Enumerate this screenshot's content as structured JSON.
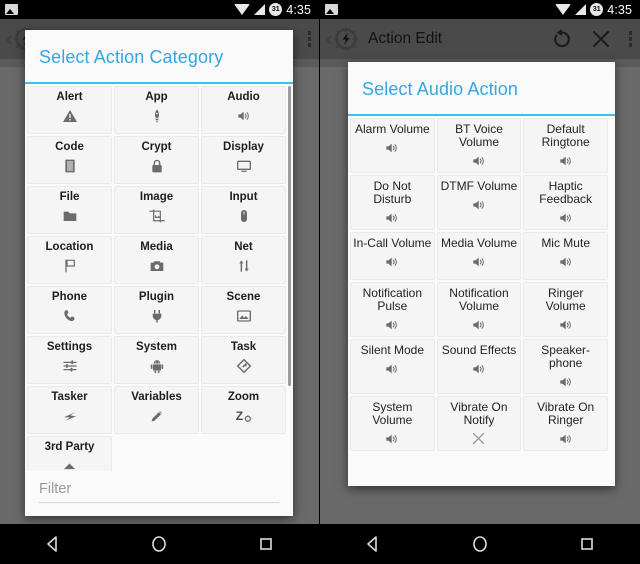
{
  "statusbar": {
    "time": "4:35",
    "icons": [
      "image-icon",
      "wifi-icon",
      "signal-icon",
      "calendar-icon"
    ],
    "calendar_day": "31"
  },
  "left_screen": {
    "toolbar": {
      "back_label": "‹",
      "logo": "tasker-logo-icon",
      "title": "",
      "overflow": "overflow-menu-icon"
    },
    "dialog": {
      "title": "Select Action Category",
      "filter_placeholder": "Filter",
      "filter_value": "",
      "items": [
        {
          "label": "Alert",
          "icon": "warning-triangle-icon"
        },
        {
          "label": "App",
          "icon": "rocket-icon"
        },
        {
          "label": "Audio",
          "icon": "speaker-icon"
        },
        {
          "label": "Code",
          "icon": "document-lines-icon"
        },
        {
          "label": "Crypt",
          "icon": "lock-icon"
        },
        {
          "label": "Display",
          "icon": "monitor-icon"
        },
        {
          "label": "File",
          "icon": "folder-icon"
        },
        {
          "label": "Image",
          "icon": "crop-image-icon"
        },
        {
          "label": "Input",
          "icon": "mouse-icon"
        },
        {
          "label": "Location",
          "icon": "flag-icon"
        },
        {
          "label": "Media",
          "icon": "camera-icon"
        },
        {
          "label": "Net",
          "icon": "up-down-arrows-icon"
        },
        {
          "label": "Phone",
          "icon": "phone-handset-icon"
        },
        {
          "label": "Plugin",
          "icon": "power-plug-icon"
        },
        {
          "label": "Scene",
          "icon": "picture-icon"
        },
        {
          "label": "Settings",
          "icon": "sliders-icon"
        },
        {
          "label": "System",
          "icon": "android-robot-icon"
        },
        {
          "label": "Task",
          "icon": "diamond-arrow-icon"
        },
        {
          "label": "Tasker",
          "icon": "lightning-bolt-icon"
        },
        {
          "label": "Variables",
          "icon": "pencil-icon"
        },
        {
          "label": "Zoom",
          "icon": "zoom-z-icon"
        },
        {
          "label": "3rd Party",
          "icon": "chevron-up-icon"
        }
      ]
    }
  },
  "right_screen": {
    "toolbar": {
      "back_label": "‹",
      "logo": "tasker-logo-icon",
      "title": "Action Edit",
      "refresh": "undo-circular-arrow-icon",
      "close": "close-x-icon",
      "overflow": "overflow-menu-icon"
    },
    "dialog": {
      "title": "Select Audio Action",
      "items": [
        {
          "label": "Alarm Volume",
          "icon": "speaker-icon",
          "disabled": false
        },
        {
          "label": "BT Voice Volume",
          "icon": "speaker-icon",
          "disabled": false
        },
        {
          "label": "Default Ringtone",
          "icon": "speaker-icon",
          "disabled": false
        },
        {
          "label": "Do Not Disturb",
          "icon": "speaker-icon",
          "disabled": false
        },
        {
          "label": "DTMF Volume",
          "icon": "speaker-icon",
          "disabled": false
        },
        {
          "label": "Haptic Feedback",
          "icon": "speaker-icon",
          "disabled": false
        },
        {
          "label": "In-Call Volume",
          "icon": "speaker-icon",
          "disabled": false
        },
        {
          "label": "Media Volume",
          "icon": "speaker-icon",
          "disabled": false
        },
        {
          "label": "Mic Mute",
          "icon": "speaker-icon",
          "disabled": false
        },
        {
          "label": "Notification Pulse",
          "icon": "speaker-icon",
          "disabled": false
        },
        {
          "label": "Notification Volume",
          "icon": "speaker-icon",
          "disabled": false
        },
        {
          "label": "Ringer Volume",
          "icon": "speaker-icon",
          "disabled": false
        },
        {
          "label": "Silent Mode",
          "icon": "speaker-icon",
          "disabled": false
        },
        {
          "label": "Sound Effects",
          "icon": "speaker-icon",
          "disabled": false
        },
        {
          "label": "Speaker-phone",
          "icon": "speaker-icon",
          "disabled": false
        },
        {
          "label": "System Volume",
          "icon": "speaker-icon",
          "disabled": false
        },
        {
          "label": "Vibrate On Notify",
          "icon": "close-x-icon",
          "disabled": true
        },
        {
          "label": "Vibrate On Ringer",
          "icon": "speaker-icon",
          "disabled": false
        }
      ]
    }
  },
  "navbar": {
    "back": "nav-back-triangle-icon",
    "home": "nav-home-circle-icon",
    "recents": "nav-recents-square-icon"
  },
  "colors": {
    "accent": "#41bdf0",
    "title_text": "#37a6e0",
    "disabled_text": "#f2554a",
    "dialog_bg": "#fafafa",
    "scrim": "#5f5f5f"
  }
}
